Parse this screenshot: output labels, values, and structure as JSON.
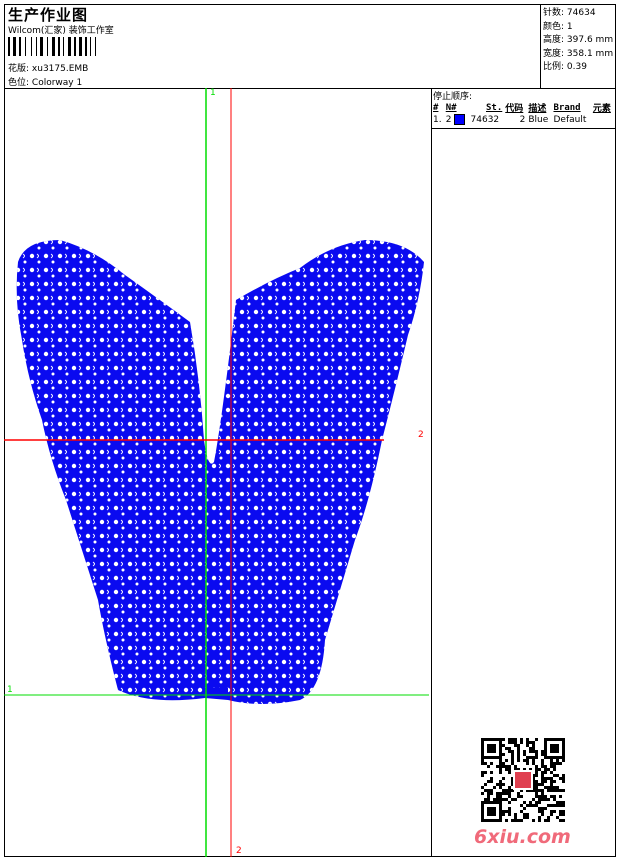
{
  "header": {
    "title": "生产作业图",
    "company": "Wilcom(汇家) 装饰工作室",
    "design_label": "花版:",
    "design_value": "xu3175.EMB",
    "colorway_label": "色位:",
    "colorway_value": "Colorway 1"
  },
  "stats": [
    {
      "label": "针数:",
      "value": "74634"
    },
    {
      "label": "颜色:",
      "value": "1"
    },
    {
      "label": "高度:",
      "value": "397.6 mm"
    },
    {
      "label": "宽度:",
      "value": "358.1 mm"
    },
    {
      "label": "比例:",
      "value": "0.39"
    }
  ],
  "stop_sequence": {
    "title": "停止顺序:",
    "columns": [
      "#",
      "N#",
      "St.",
      "代码",
      "描述",
      "Brand",
      "元素"
    ],
    "rows": [
      {
        "index": "1.",
        "needle": "2",
        "color": "#0000ff",
        "stitches": "74632",
        "code": "2",
        "description": "Blue",
        "brand": "Default",
        "element": ""
      }
    ]
  },
  "guides": {
    "green_label": "1",
    "red_label": "2",
    "green_color": "#00dd00",
    "red_color": "#ff0000"
  },
  "design_color": "#0a0af0",
  "watermark": "6xiu.com"
}
